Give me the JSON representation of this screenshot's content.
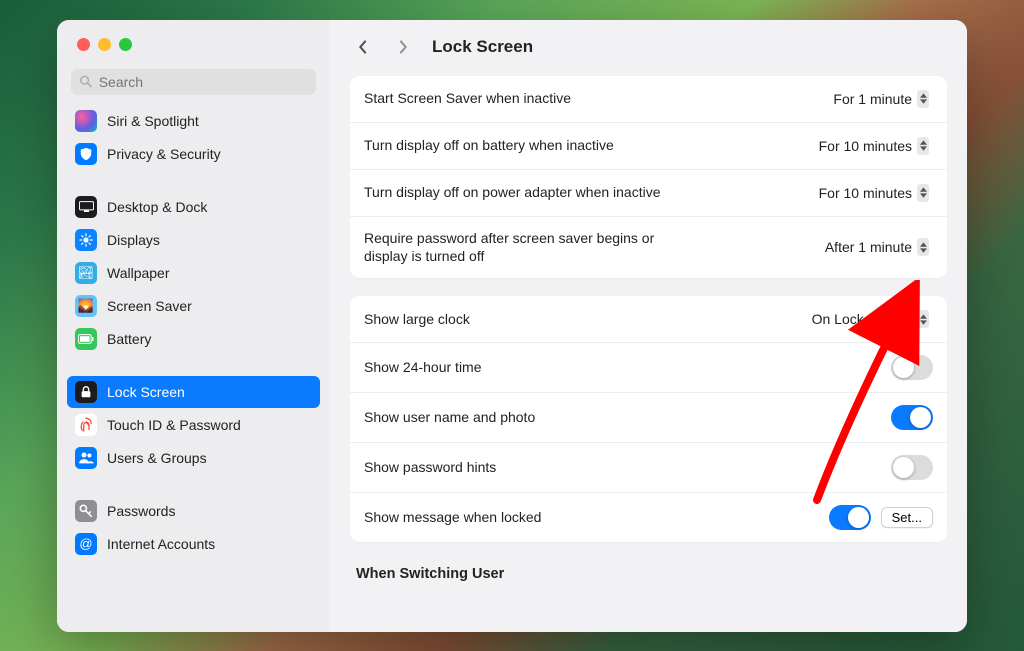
{
  "search_placeholder": "Search",
  "title": "Lock Screen",
  "sidebar": {
    "items": [
      {
        "id": "siri",
        "label": "Siri & Spotlight",
        "iconClass": "ic-siri"
      },
      {
        "id": "privacy",
        "label": "Privacy & Security",
        "iconClass": "ic-privacy"
      },
      {
        "id": "desktop",
        "label": "Desktop & Dock",
        "iconClass": "ic-desktop",
        "sectionStart": true
      },
      {
        "id": "displays",
        "label": "Displays",
        "iconClass": "ic-displays"
      },
      {
        "id": "wallpaper",
        "label": "Wallpaper",
        "iconClass": "ic-wallpaper"
      },
      {
        "id": "screensaver",
        "label": "Screen Saver",
        "iconClass": "ic-screensaver"
      },
      {
        "id": "battery",
        "label": "Battery",
        "iconClass": "ic-battery"
      },
      {
        "id": "lockscreen",
        "label": "Lock Screen",
        "iconClass": "ic-lock",
        "active": true,
        "sectionStart": true
      },
      {
        "id": "touchid",
        "label": "Touch ID & Password",
        "iconClass": "ic-touchid"
      },
      {
        "id": "users",
        "label": "Users & Groups",
        "iconClass": "ic-users"
      },
      {
        "id": "passwords",
        "label": "Passwords",
        "iconClass": "ic-passwords",
        "sectionStart": true
      },
      {
        "id": "internet",
        "label": "Internet Accounts",
        "iconClass": "ic-internet"
      }
    ]
  },
  "group1": [
    {
      "label": "Start Screen Saver when inactive",
      "value": "For 1 minute",
      "type": "picker"
    },
    {
      "label": "Turn display off on battery when inactive",
      "value": "For 10 minutes",
      "type": "picker"
    },
    {
      "label": "Turn display off on power adapter when inactive",
      "value": "For 10 minutes",
      "type": "picker"
    },
    {
      "label": "Require password after screen saver begins or display is turned off",
      "value": "After 1 minute",
      "type": "picker"
    }
  ],
  "group2": [
    {
      "label": "Show large clock",
      "value": "On Lock Screen",
      "type": "picker"
    },
    {
      "label": "Show 24-hour time",
      "type": "toggle",
      "on": false
    },
    {
      "label": "Show user name and photo",
      "type": "toggle",
      "on": true
    },
    {
      "label": "Show password hints",
      "type": "toggle",
      "on": false
    },
    {
      "label": "Show message when locked",
      "type": "toggle",
      "on": true,
      "button": "Set..."
    }
  ],
  "section3_title": "When Switching User"
}
